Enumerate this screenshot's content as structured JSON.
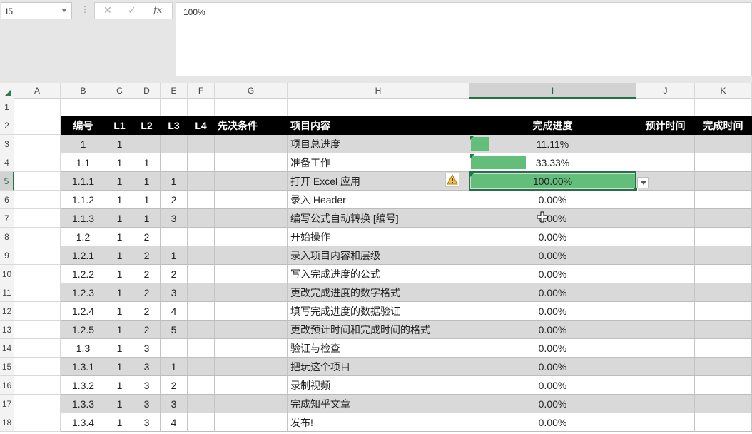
{
  "formula_bar": {
    "name_box": "I5",
    "more_icon": "vertical-dots-icon",
    "cancel_icon": "x",
    "enter_icon": "check",
    "function_icon": "fx",
    "cancel_symbol": "✕",
    "enter_symbol": "✓",
    "function_symbol": "fx",
    "value": "100%"
  },
  "columns": [
    "A",
    "B",
    "C",
    "D",
    "E",
    "F",
    "G",
    "H",
    "I",
    "J",
    "K"
  ],
  "selected_column": "I",
  "selected_row": 5,
  "header_row": {
    "B": "编号",
    "C": "L1",
    "D": "L2",
    "E": "L3",
    "F": "L4",
    "G": "先决条件",
    "H": "项目内容",
    "I": "完成进度",
    "J": "预计时间",
    "K": "完成时间"
  },
  "rows": [
    {
      "num": "1",
      "B": "",
      "C": "",
      "D": "",
      "E": "",
      "F": "",
      "G": "",
      "H": "",
      "I": "",
      "progress": null
    },
    {
      "num": "2"
    },
    {
      "num": "3",
      "B": "1",
      "C": "1",
      "D": "",
      "E": "",
      "F": "",
      "G": "",
      "H": "项目总进度",
      "I": "11.11%",
      "progress": 0.1111
    },
    {
      "num": "4",
      "B": "1.1",
      "C": "1",
      "D": "1",
      "E": "",
      "F": "",
      "G": "",
      "H": "准备工作",
      "I": "33.33%",
      "progress": 0.3333
    },
    {
      "num": "5",
      "B": "1.1.1",
      "C": "1",
      "D": "1",
      "E": "1",
      "F": "",
      "G": "",
      "H": "打开 Excel 应用",
      "I": "100.00%",
      "progress": 1.0
    },
    {
      "num": "6",
      "B": "1.1.2",
      "C": "1",
      "D": "1",
      "E": "2",
      "F": "",
      "G": "",
      "H": "录入 Header",
      "I": "0.00%",
      "progress": 0
    },
    {
      "num": "7",
      "B": "1.1.3",
      "C": "1",
      "D": "1",
      "E": "3",
      "F": "",
      "G": "",
      "H": "编写公式自动转换 [编号]",
      "I": "0.00%",
      "progress": 0
    },
    {
      "num": "8",
      "B": "1.2",
      "C": "1",
      "D": "2",
      "E": "",
      "F": "",
      "G": "",
      "H": "开始操作",
      "I": "0.00%",
      "progress": 0
    },
    {
      "num": "9",
      "B": "1.2.1",
      "C": "1",
      "D": "2",
      "E": "1",
      "F": "",
      "G": "",
      "H": "录入项目内容和层级",
      "I": "0.00%",
      "progress": 0
    },
    {
      "num": "10",
      "B": "1.2.2",
      "C": "1",
      "D": "2",
      "E": "2",
      "F": "",
      "G": "",
      "H": "写入完成进度的公式",
      "I": "0.00%",
      "progress": 0
    },
    {
      "num": "11",
      "B": "1.2.3",
      "C": "1",
      "D": "2",
      "E": "3",
      "F": "",
      "G": "",
      "H": "更改完成进度的数字格式",
      "I": "0.00%",
      "progress": 0
    },
    {
      "num": "12",
      "B": "1.2.4",
      "C": "1",
      "D": "2",
      "E": "4",
      "F": "",
      "G": "",
      "H": "填写完成进度的数据验证",
      "I": "0.00%",
      "progress": 0
    },
    {
      "num": "13",
      "B": "1.2.5",
      "C": "1",
      "D": "2",
      "E": "5",
      "F": "",
      "G": "",
      "H": "更改预计时间和完成时间的格式",
      "I": "0.00%",
      "progress": 0
    },
    {
      "num": "14",
      "B": "1.3",
      "C": "1",
      "D": "3",
      "E": "",
      "F": "",
      "G": "",
      "H": "验证与检查",
      "I": "0.00%",
      "progress": 0
    },
    {
      "num": "15",
      "B": "1.3.1",
      "C": "1",
      "D": "3",
      "E": "1",
      "F": "",
      "G": "",
      "H": "把玩这个项目",
      "I": "0.00%",
      "progress": 0
    },
    {
      "num": "16",
      "B": "1.3.2",
      "C": "1",
      "D": "3",
      "E": "2",
      "F": "",
      "G": "",
      "H": "录制视频",
      "I": "0.00%",
      "progress": 0
    },
    {
      "num": "17",
      "B": "1.3.3",
      "C": "1",
      "D": "3",
      "E": "3",
      "F": "",
      "G": "",
      "H": "完成知乎文章",
      "I": "0.00%",
      "progress": 0
    },
    {
      "num": "18",
      "B": "1.3.4",
      "C": "1",
      "D": "3",
      "E": "4",
      "F": "",
      "G": "",
      "H": "发布!",
      "I": "0.00%",
      "progress": 0
    }
  ],
  "colors": {
    "progress_fill": "#63be7b",
    "header_bg": "#000000",
    "band_bg": "#d9d9d9",
    "selection": "#217346"
  },
  "icons": {
    "warning": "warning-triangle-icon",
    "dropdown": "dropdown-arrow-icon",
    "cursor": "cross-cursor-icon"
  }
}
